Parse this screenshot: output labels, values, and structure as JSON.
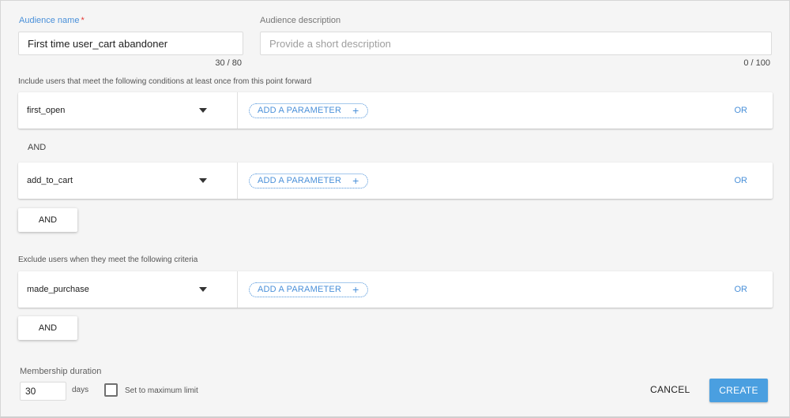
{
  "audience_name": {
    "label": "Audience name",
    "required_mark": "*",
    "value": "First time user_cart abandoner",
    "counter": "30 / 80"
  },
  "audience_description": {
    "label": "Audience description",
    "placeholder": "Provide a short description",
    "counter": "0 / 100"
  },
  "include": {
    "label": "Include users that meet the following conditions at least once from this point forward",
    "conditions": [
      {
        "event": "first_open",
        "add_parameter_label": "ADD A PARAMETER",
        "or_label": "OR"
      },
      {
        "event": "add_to_cart",
        "add_parameter_label": "ADD A PARAMETER",
        "or_label": "OR"
      }
    ],
    "and_separator": "AND",
    "and_button": "AND"
  },
  "exclude": {
    "label": "Exclude users when they meet the following criteria",
    "conditions": [
      {
        "event": "made_purchase",
        "add_parameter_label": "ADD A PARAMETER",
        "or_label": "OR"
      }
    ],
    "and_button": "AND"
  },
  "membership": {
    "label": "Membership duration",
    "value": "30",
    "unit": "days",
    "max_limit_label": "Set to maximum limit",
    "max_limit_checked": false
  },
  "actions": {
    "cancel_label": "CANCEL",
    "create_label": "CREATE"
  },
  "colors": {
    "accent": "#4a90d9",
    "create_button": "#4a9fe0",
    "required": "#e53935"
  },
  "icons": {
    "dropdown": "caret-down-icon",
    "add": "plus-icon"
  }
}
